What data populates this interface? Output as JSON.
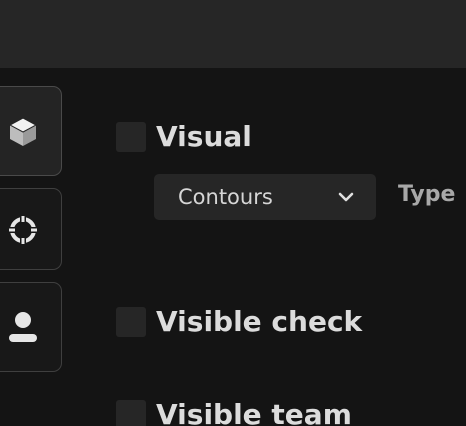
{
  "sidebar": {
    "tabs": [
      {
        "id": "visuals",
        "icon": "cube-icon",
        "active": true
      },
      {
        "id": "aimbot",
        "icon": "crosshair-icon",
        "active": false
      },
      {
        "id": "player",
        "icon": "user-icon",
        "active": false
      }
    ]
  },
  "options": {
    "visual": {
      "label": "Visual",
      "checked": false
    },
    "visual_style": {
      "selected": "Contours",
      "type_label": "Type"
    },
    "visible_check": {
      "label": "Visible check",
      "checked": false
    },
    "visible_team": {
      "label": "Visible team",
      "checked": false
    }
  },
  "colors": {
    "background": "#141414",
    "topbar": "#262626",
    "text": "#dcdcdc",
    "muted_text": "#a8a8a8",
    "control": "#262626"
  }
}
